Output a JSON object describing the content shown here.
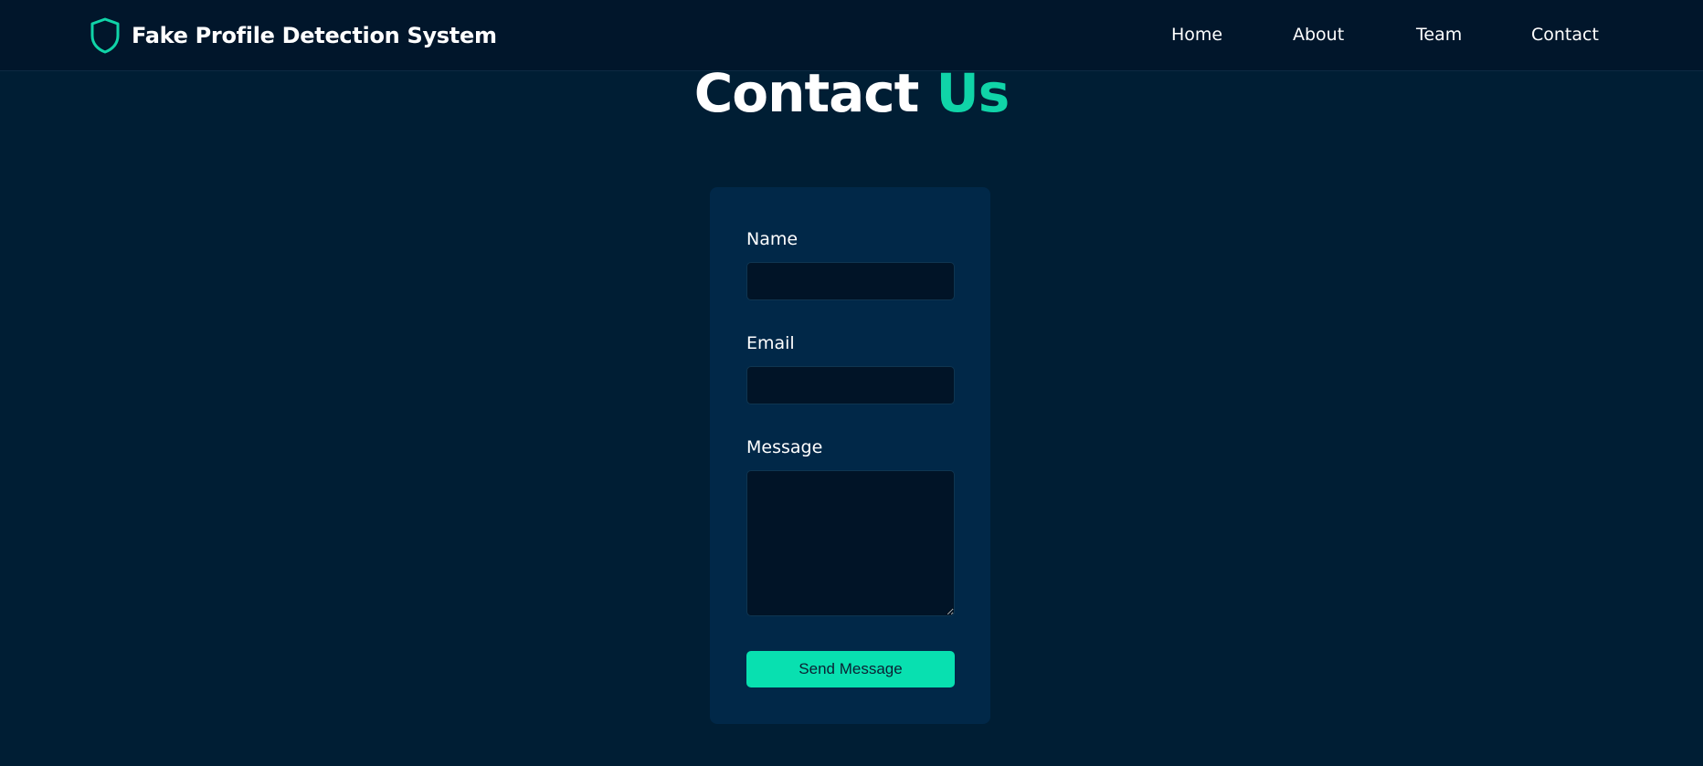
{
  "header": {
    "brand_title": "Fake Profile Detection System",
    "brand_icon": "shield-icon",
    "nav": {
      "home": "Home",
      "about": "About",
      "team": "Team",
      "contact": "Contact"
    }
  },
  "page": {
    "heading_main": "Contact",
    "heading_accent": "Us"
  },
  "form": {
    "name_label": "Name",
    "name_value": "",
    "email_label": "Email",
    "email_value": "",
    "message_label": "Message",
    "message_value": "",
    "submit_label": "Send Message"
  },
  "colors": {
    "background": "#001e34",
    "header_background": "#01162b",
    "card_background": "#012848",
    "input_background": "#011427",
    "accent": "#10d4a8",
    "button": "#08e0b0"
  }
}
